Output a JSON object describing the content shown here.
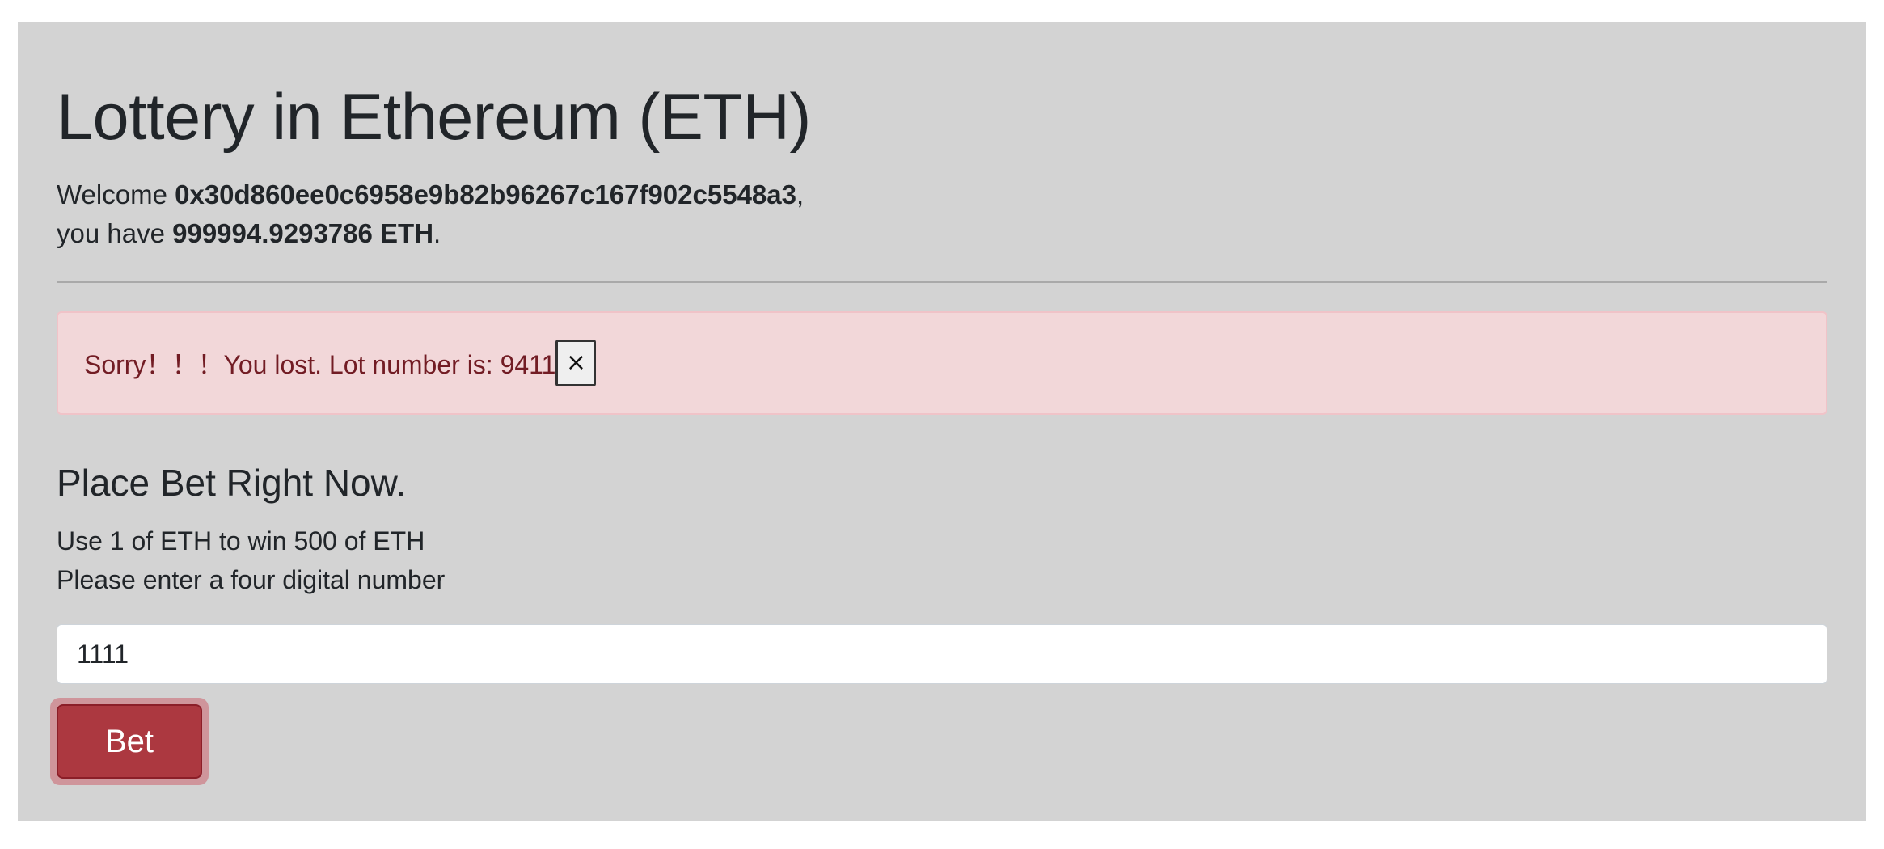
{
  "header": {
    "title": "Lottery in Ethereum (ETH)"
  },
  "account": {
    "welcome_prefix": "Welcome ",
    "address": "0x30d860ee0c6958e9b82b96267c167f902c5548a3",
    "welcome_suffix": ",",
    "balance_prefix": "you have ",
    "balance": "999994.9293786 ETH",
    "balance_suffix": "."
  },
  "alert": {
    "message": "Sorry！！！You lost. Lot number is: 9411",
    "close_label": "×",
    "status_color": "#721c24"
  },
  "bet": {
    "heading": "Place Bet Right Now.",
    "rule": "Use 1 of ETH to win 500 of ETH",
    "instruction": "Please enter a four digital number",
    "input_value": "1111",
    "button_label": "Bet",
    "button_color": "#ac3840"
  }
}
